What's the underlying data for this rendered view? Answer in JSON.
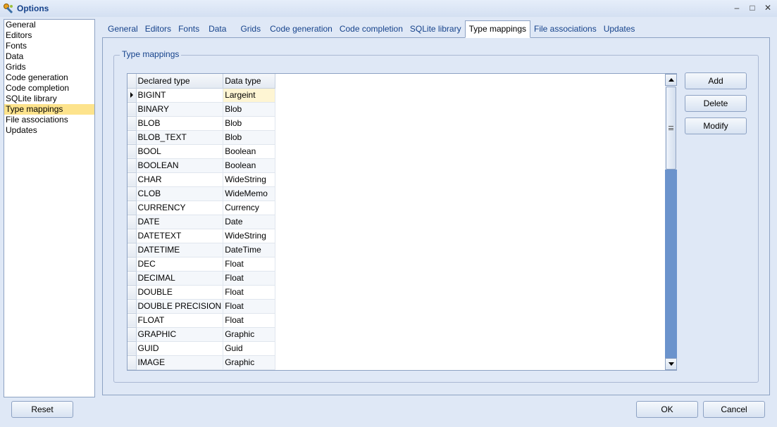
{
  "window": {
    "title": "Options",
    "controls": [
      "–",
      "□",
      "✕"
    ]
  },
  "sidebar": {
    "items": [
      {
        "label": "General"
      },
      {
        "label": "Editors"
      },
      {
        "label": "Fonts"
      },
      {
        "label": "Data"
      },
      {
        "label": "Grids"
      },
      {
        "label": "Code generation"
      },
      {
        "label": "Code completion"
      },
      {
        "label": "SQLite library"
      },
      {
        "label": "Type mappings"
      },
      {
        "label": "File associations"
      },
      {
        "label": "Updates"
      }
    ],
    "selected": "Type mappings"
  },
  "tabs": [
    {
      "label": "General"
    },
    {
      "label": "Editors"
    },
    {
      "label": "Fonts"
    },
    {
      "label": "Data"
    },
    {
      "label": "Grids"
    },
    {
      "label": "Code generation"
    },
    {
      "label": "Code completion"
    },
    {
      "label": "SQLite library"
    },
    {
      "label": "Type mappings"
    },
    {
      "label": "File associations"
    },
    {
      "label": "Updates"
    }
  ],
  "active_tab": "Type mappings",
  "group": {
    "label": "Type mappings"
  },
  "grid": {
    "columns": [
      "Declared type",
      "Data type"
    ],
    "rows": [
      [
        "BIGINT",
        "Largeint"
      ],
      [
        "BINARY",
        "Blob"
      ],
      [
        "BLOB",
        "Blob"
      ],
      [
        "BLOB_TEXT",
        "Blob"
      ],
      [
        "BOOL",
        "Boolean"
      ],
      [
        "BOOLEAN",
        "Boolean"
      ],
      [
        "CHAR",
        "WideString"
      ],
      [
        "CLOB",
        "WideMemo"
      ],
      [
        "CURRENCY",
        "Currency"
      ],
      [
        "DATE",
        "Date"
      ],
      [
        "DATETEXT",
        "WideString"
      ],
      [
        "DATETIME",
        "DateTime"
      ],
      [
        "DEC",
        "Float"
      ],
      [
        "DECIMAL",
        "Float"
      ],
      [
        "DOUBLE",
        "Float"
      ],
      [
        "DOUBLE PRECISION",
        "Float"
      ],
      [
        "FLOAT",
        "Float"
      ],
      [
        "GRAPHIC",
        "Graphic"
      ],
      [
        "GUID",
        "Guid"
      ],
      [
        "IMAGE",
        "Graphic"
      ]
    ]
  },
  "actions": {
    "add": "Add",
    "delete": "Delete",
    "modify": "Modify"
  },
  "footer": {
    "reset": "Reset",
    "ok": "OK",
    "cancel": "Cancel"
  }
}
